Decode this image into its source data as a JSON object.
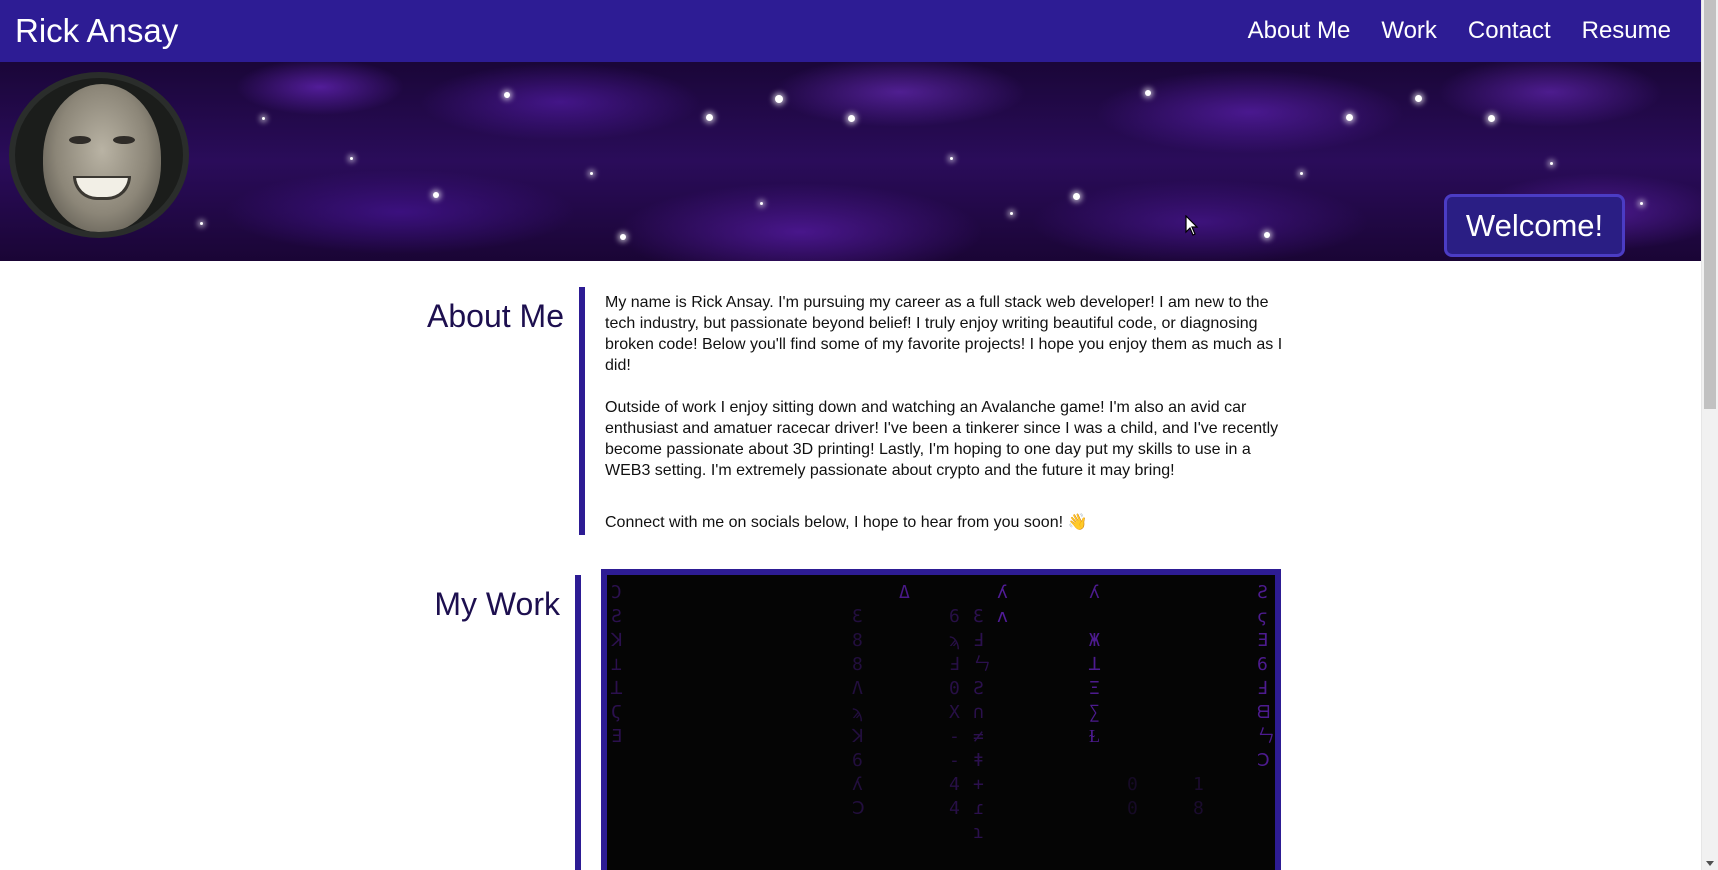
{
  "navbar": {
    "brand": "Rick Ansay",
    "links": [
      "About Me",
      "Work",
      "Contact",
      "Resume"
    ]
  },
  "hero": {
    "welcome": "Welcome!"
  },
  "about": {
    "heading": "About Me",
    "paragraphs": [
      "My name is Rick Ansay. I'm pursuing my career as a full stack web developer! I am new to the tech industry, but passionate beyond belief! I truly enjoy writing beautiful code, or diagnosing broken code! Below you'll find some of my favorite projects! I hope you enjoy them as much as I did!",
      "Outside of work I enjoy sitting down and watching an Avalanche game! I'm also an avid car enthusiast and amatuer racecar driver! I've been a tinkerer since I was a child, and I've recently become passionate about 3D printing! Lastly, I'm hoping to one day put my skills to use in a WEB3 setting. I'm extremely passionate about crypto and the future it may bring!"
    ],
    "connect": "Connect with me on socials below, I hope to hear from you soon! 👋"
  },
  "work": {
    "heading": "My Work"
  },
  "colors": {
    "accent": "#2d1c94",
    "heading_text": "#1d0f4f",
    "matrix_glyph": "#5a1fa8"
  },
  "icons": {
    "avatar": "profile-photo",
    "cursor": "mouse-pointer-icon"
  }
}
